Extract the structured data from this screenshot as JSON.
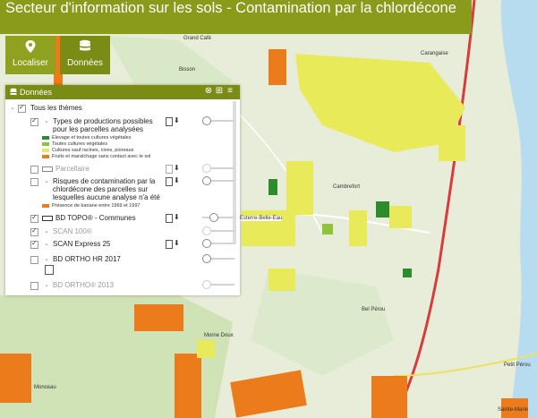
{
  "header": {
    "title": "Secteur d'information sur les sols - Contamination par la chlordécone"
  },
  "toolbar": {
    "localiser_label": "Localiser",
    "donnees_label": "Données"
  },
  "panel": {
    "title": "Données",
    "all_themes": "Tous les thèmes",
    "layers": [
      {
        "name": "Types de productions possibles pour les parcelles analysées",
        "checked": true
      },
      {
        "name": "Parcellaire",
        "checked": false
      },
      {
        "name": "Risques de contamination par la chlordécone des parcelles sur lesquelles aucune analyse n'a été réalisée",
        "checked": false
      },
      {
        "name": "BD TOPO® - Communes",
        "checked": true
      },
      {
        "name": "SCAN 100®",
        "checked": true
      },
      {
        "name": "SCAN Express 25",
        "checked": true
      },
      {
        "name": "BD ORTHO HR 2017",
        "checked": false
      },
      {
        "name": "BD ORTHO® 2013",
        "checked": false
      }
    ],
    "legend_productions": [
      {
        "label": "Elevage et toutes cultures végétales",
        "color": "#2e8b2e"
      },
      {
        "label": "Toutes cultures végétales",
        "color": "#8cc43c"
      },
      {
        "label": "Cultures sauf racines, cives, poireaux",
        "color": "#e9ea5a"
      },
      {
        "label": "Fruits et maraîchage sans contact avec le sol",
        "color": "#ec7b1c"
      }
    ],
    "legend_risque": [
      {
        "label": "Présence de banane entre 1969 et 1997",
        "color": "#ec7b1c"
      }
    ]
  },
  "map_labels": {
    "carangaise": "Carangaise",
    "cambrefort": "Cambrefort",
    "esterre": "Esterre-Belle-Eau",
    "bel_perou": "Bel Pérou",
    "grand_cafe": "Grand Café",
    "bisson": "Bisson",
    "monceau": "Monceau",
    "petit_perou": "Petit Pérou",
    "sainte_marie": "Sainte-Marie",
    "morne": "Morne Doux"
  },
  "colors": {
    "accent": "#8a9a1a",
    "orange": "#ec7b1c",
    "yellow": "#e9ea5a",
    "green": "#2e8b2e"
  }
}
